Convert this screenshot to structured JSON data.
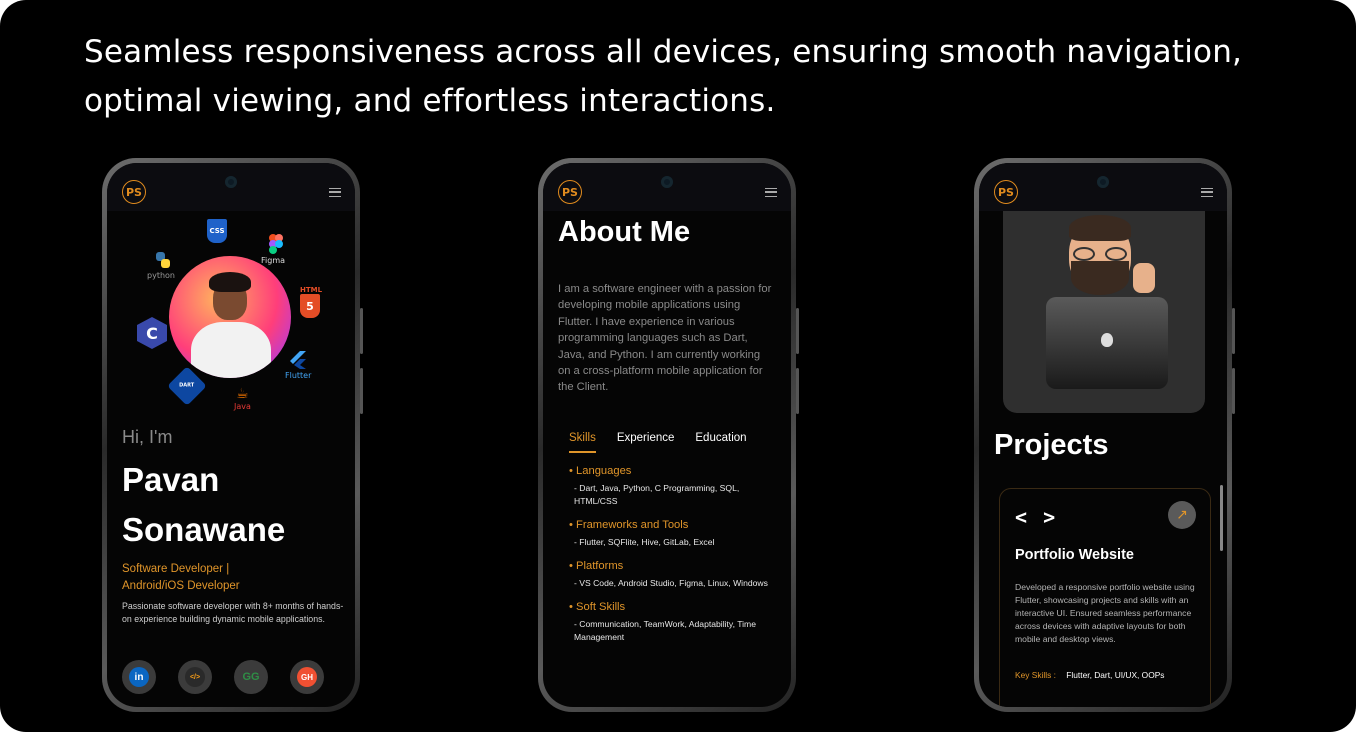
{
  "headline": "Seamless responsiveness across all devices, ensuring smooth navigation, optimal viewing, and effortless interactions.",
  "logo_text": "PS",
  "phone1": {
    "tech_labels": {
      "python": "python",
      "css": "CSS",
      "figma": "Figma",
      "html": "HTML",
      "c": "C",
      "flutter": "Flutter",
      "dart": "DART",
      "java": "Java"
    },
    "greeting": "Hi, I'm",
    "name_line1": "Pavan",
    "name_line2": "Sonawane",
    "role_line1": "Software Developer |",
    "role_line2": "Android/iOS Developer",
    "bio": "Passionate software developer with 8+ months of hands-on experience building dynamic mobile applications.",
    "socials": [
      {
        "icon": "linkedin-icon",
        "glyph": "in",
        "color": "#0a66c2"
      },
      {
        "icon": "leetcode-icon",
        "glyph": "</>",
        "color": "#ffa116"
      },
      {
        "icon": "geeksforgeeks-icon",
        "glyph": "GG",
        "color": "#2f8d46"
      },
      {
        "icon": "github-icon",
        "glyph": "GH",
        "color": "#f05032"
      }
    ]
  },
  "phone2": {
    "title": "About Me",
    "text": "I am a software engineer with a passion for developing mobile applications using Flutter. I have experience in various programming languages such as Dart, Java, and Python. I am currently working on a cross-platform mobile application for the Client.",
    "tabs": [
      "Skills",
      "Experience",
      "Education"
    ],
    "skills": [
      {
        "category": "• Languages",
        "items": "- Dart, Java, Python, C Programming, SQL, HTML/CSS"
      },
      {
        "category": "• Frameworks and Tools",
        "items": "- Flutter, SQFlite, Hive, GitLab, Excel"
      },
      {
        "category": "• Platforms",
        "items": "- VS Code, Android Studio, Figma, Linux, Windows"
      },
      {
        "category": "• Soft Skills",
        "items": "- Communication, TeamWork, Adaptability, Time Management"
      }
    ]
  },
  "phone3": {
    "title": "Projects",
    "project": {
      "code_glyph": "< >",
      "name": "Portfolio Website",
      "description": "Developed a responsive portfolio website using Flutter, showcasing projects and skills with an interactive UI. Ensured seamless performance across devices with adaptive layouts for both mobile and desktop views.",
      "skills_label": "Key Skills :",
      "skills_value": "Flutter, Dart, UI/UX, OOPs"
    }
  },
  "colors": {
    "accent": "#e0952a",
    "background": "#000000"
  }
}
